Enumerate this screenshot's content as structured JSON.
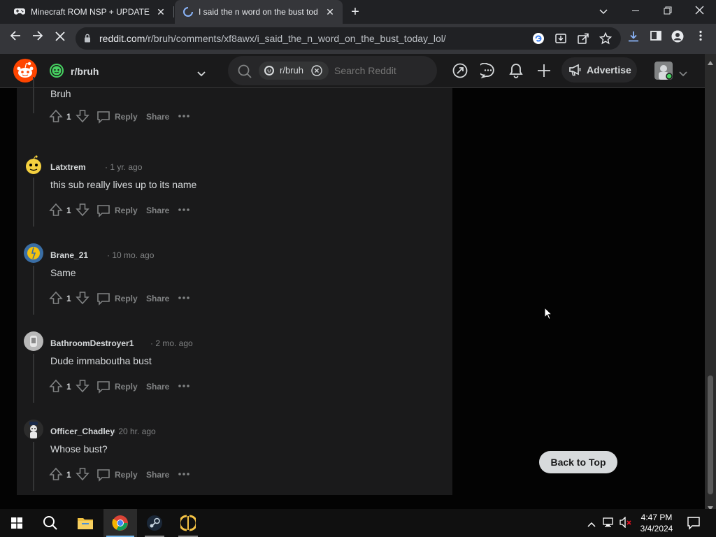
{
  "browser": {
    "tabs": [
      {
        "title": "Minecraft ROM NSP + UPDATE -",
        "icon": "gamepad-icon"
      },
      {
        "title": "I said the n word on the bust tod",
        "icon": "loading-spinner-icon"
      }
    ],
    "url_host": "reddit.com",
    "url_path": "/r/bruh/comments/xf8awx/i_said_the_n_word_on_the_bust_today_lol/"
  },
  "reddit": {
    "subreddit": "r/bruh",
    "search_chip": "r/bruh",
    "search_placeholder": "Search Reddit",
    "advertise": "Advertise",
    "back_to_top": "Back to Top",
    "top_comment": {
      "body": "Bruh",
      "score": "1",
      "reply": "Reply",
      "share": "Share"
    },
    "comments": [
      {
        "author": "Latxtrem",
        "age": "· 1 yr. ago",
        "body": "this sub really lives up to its name",
        "score": "1",
        "reply": "Reply",
        "share": "Share",
        "avatar_color": "#f4d03f"
      },
      {
        "author": "Brane_21",
        "age": "· 10 mo. ago",
        "body": "Same",
        "score": "1",
        "reply": "Reply",
        "share": "Share",
        "avatar_color": "#3a6ea5"
      },
      {
        "author": "BathroomDestroyer1",
        "age": "· 2 mo. ago",
        "body": "Dude immaboutha bust",
        "score": "1",
        "reply": "Reply",
        "share": "Share",
        "avatar_color": "#b8b8b8"
      },
      {
        "author": "Officer_Chadley",
        "age": "· 20 hr. ago",
        "body": "Whose bust?",
        "score": "1",
        "reply": "Reply",
        "share": "Share",
        "avatar_color": "#2c2c2c"
      }
    ]
  },
  "taskbar": {
    "time": "4:47 PM",
    "date": "3/4/2024"
  },
  "colors": {
    "reddit_orange": "#ff4500",
    "panel_bg": "#1a1a1b",
    "page_bg": "#030303",
    "text_primary": "#d7dadc",
    "text_muted": "#818384"
  }
}
